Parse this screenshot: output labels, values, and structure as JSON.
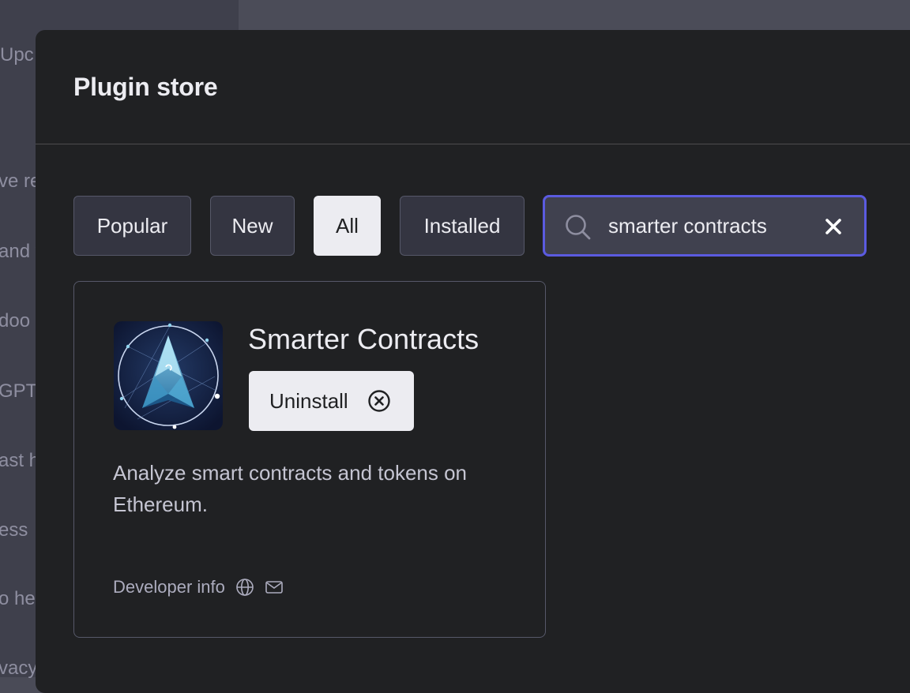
{
  "background": {
    "fragments": [
      "Upc",
      "ve re",
      "and y",
      "doo",
      "GPT",
      "ast h",
      "ess",
      "o he",
      "vacy"
    ]
  },
  "modal": {
    "title": "Plugin store",
    "tabs": [
      {
        "label": "Popular",
        "active": false
      },
      {
        "label": "New",
        "active": false
      },
      {
        "label": "All",
        "active": true
      },
      {
        "label": "Installed",
        "active": false
      }
    ],
    "search": {
      "value": "smarter contracts",
      "icon": "search-icon",
      "clear_icon": "close-icon"
    }
  },
  "plugin": {
    "name": "Smarter Contracts",
    "action_label": "Uninstall",
    "action_icon": "circle-x-icon",
    "description": "Analyze smart contracts and tokens on Ethereum.",
    "developer_label": "Developer info",
    "developer_icons": [
      "globe-icon",
      "mail-icon"
    ]
  },
  "colors": {
    "accent_focus": "#5b5be0",
    "modal_bg": "#202123",
    "tab_active_bg": "#ececf1",
    "tab_bg": "#343541"
  }
}
